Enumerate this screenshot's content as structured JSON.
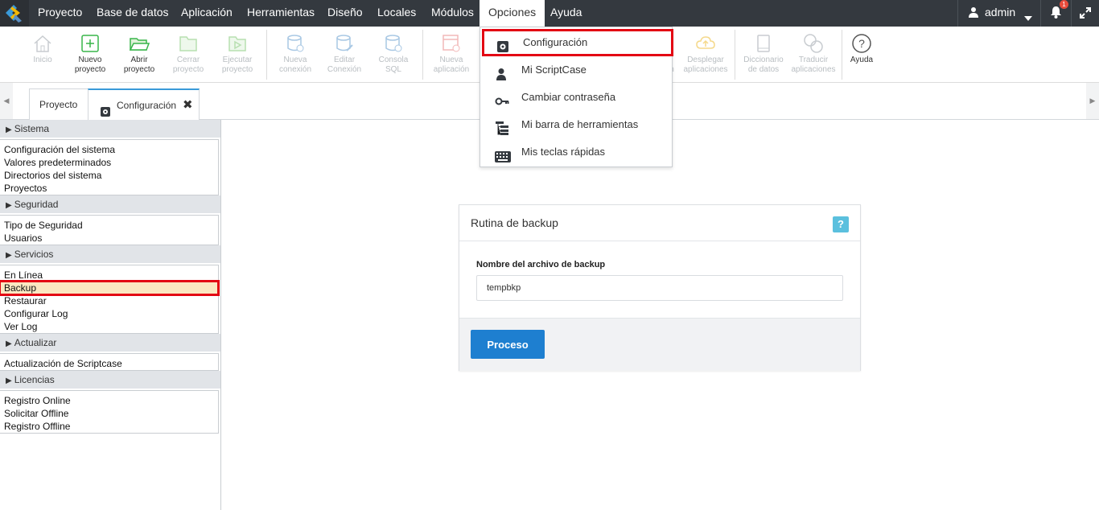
{
  "menubar": {
    "items": [
      "Proyecto",
      "Base de datos",
      "Aplicación",
      "Herramientas",
      "Diseño",
      "Locales",
      "Módulos",
      "Opciones",
      "Ayuda"
    ],
    "active_item": "Opciones",
    "user": "admin",
    "notification_count": "1"
  },
  "toolbar": {
    "tools": [
      {
        "label1": "Inicio",
        "label2": ""
      },
      {
        "label1": "Nuevo",
        "label2": "proyecto"
      },
      {
        "label1": "Abrir",
        "label2": "proyecto"
      },
      {
        "label1": "Cerrar",
        "label2": "proyecto"
      },
      {
        "label1": "Ejecutar",
        "label2": "proyecto"
      },
      {
        "label1": "Nueva",
        "label2": "conexión"
      },
      {
        "label1": "Editar",
        "label2": "Conexión"
      },
      {
        "label1": "Consola",
        "label2": "SQL"
      },
      {
        "label1": "Nueva",
        "label2": "aplicación"
      },
      {
        "label1": "",
        "label2": "n"
      },
      {
        "label1": "Desplegar",
        "label2": "aplicaciones"
      },
      {
        "label1": "Diccionario",
        "label2": "de datos"
      },
      {
        "label1": "Traducir",
        "label2": "aplicaciones"
      },
      {
        "label1": "Ayuda",
        "label2": ""
      }
    ]
  },
  "tabs": [
    {
      "label": "Proyecto"
    },
    {
      "label": "Configuración"
    }
  ],
  "sidebar": {
    "sections": [
      {
        "title": "Sistema",
        "items": [
          "Configuración del sistema",
          "Valores predeterminados",
          "Directorios del sistema",
          "Proyectos"
        ]
      },
      {
        "title": "Seguridad",
        "items": [
          "Tipo de Seguridad",
          "Usuarios"
        ]
      },
      {
        "title": "Servicios",
        "items": [
          "En Línea",
          "Backup",
          "Restaurar",
          "Configurar Log",
          "Ver Log"
        ]
      },
      {
        "title": "Actualizar",
        "items": [
          "Actualización de Scriptcase"
        ]
      },
      {
        "title": "Licencias",
        "items": [
          "Registro Online",
          "Solicitar Offline",
          "Registro Offline"
        ]
      }
    ],
    "selected_item": "Backup"
  },
  "panel": {
    "title": "Rutina de backup",
    "help": "?",
    "field_label": "Nombre del archivo de backup",
    "field_value": "tempbkp",
    "button": "Proceso"
  },
  "dropdown": {
    "items": [
      {
        "label": "Configuración",
        "icon": "gear-icon"
      },
      {
        "label": "Mi ScriptCase",
        "icon": "user-icon"
      },
      {
        "label": "Cambiar contraseña",
        "icon": "key-icon"
      },
      {
        "label": "Mi barra de herramientas",
        "icon": "toolbar-tree-icon"
      },
      {
        "label": "Mis teclas rápidas",
        "icon": "keyboard-icon"
      }
    ]
  },
  "colors": {
    "menubar_bg": "#34393f",
    "accent_blue": "#1e7fd0",
    "highlight_red": "#e30613",
    "selected_bg": "#fbe7c1",
    "help_badge": "#5bc0de"
  }
}
